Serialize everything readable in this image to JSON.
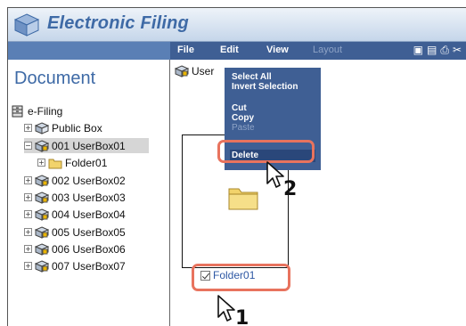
{
  "app": {
    "title": "Electronic Filing"
  },
  "menubar": {
    "items": [
      {
        "label": "File",
        "enabled": true
      },
      {
        "label": "Edit",
        "enabled": true
      },
      {
        "label": "View",
        "enabled": true
      },
      {
        "label": "Layout",
        "enabled": false
      }
    ],
    "tool_icons": [
      "scan-icon",
      "save-icon",
      "print-icon",
      "cut-icon"
    ]
  },
  "sidebar": {
    "heading": "Document",
    "tree": [
      {
        "label": "e-Filing",
        "icon": "cabinet-icon"
      },
      {
        "label": "Public Box",
        "icon": "box-icon"
      },
      {
        "label": "001 UserBox01",
        "icon": "userbox-icon",
        "selected": true
      },
      {
        "label": "Folder01",
        "icon": "folder-icon"
      },
      {
        "label": "002 UserBox02",
        "icon": "userbox-icon"
      },
      {
        "label": "003 UserBox03",
        "icon": "userbox-icon"
      },
      {
        "label": "004 UserBox04",
        "icon": "userbox-icon"
      },
      {
        "label": "005 UserBox05",
        "icon": "userbox-icon"
      },
      {
        "label": "006 UserBox06",
        "icon": "userbox-icon"
      },
      {
        "label": "007 UserBox07",
        "icon": "userbox-icon"
      }
    ]
  },
  "main": {
    "path_label": "User",
    "folder_label": "Folder01",
    "folder_checked": true
  },
  "edit_menu": {
    "items": [
      {
        "label": "Select All",
        "enabled": true
      },
      {
        "label": "Invert Selection",
        "enabled": true
      },
      {
        "label": "Cut",
        "enabled": true
      },
      {
        "label": "Copy",
        "enabled": true
      },
      {
        "label": "Paste",
        "enabled": false
      },
      {
        "label": "Delete",
        "enabled": true,
        "highlighted": true
      }
    ]
  },
  "annotations": {
    "step_1": "1",
    "step_2": "2",
    "callout_color": "#e8735e"
  },
  "colors": {
    "title_text": "#3e6aa6",
    "menubar_bg": "#3f5f94",
    "link_text": "#2e58a4"
  }
}
